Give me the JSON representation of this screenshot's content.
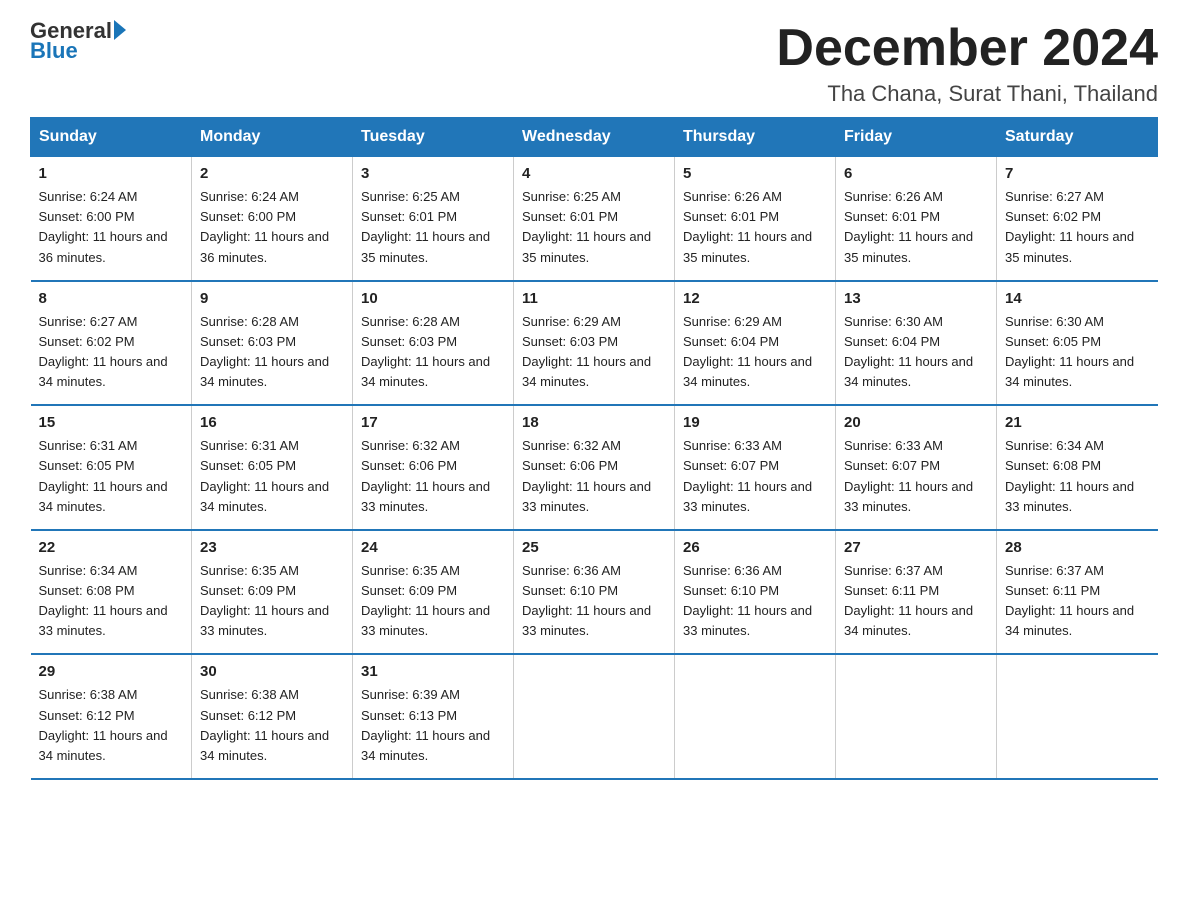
{
  "header": {
    "logo_line1": "General",
    "logo_line2": "Blue",
    "month_title": "December 2024",
    "location": "Tha Chana, Surat Thani, Thailand"
  },
  "days_of_week": [
    "Sunday",
    "Monday",
    "Tuesday",
    "Wednesday",
    "Thursday",
    "Friday",
    "Saturday"
  ],
  "weeks": [
    [
      {
        "day": "1",
        "info": "Sunrise: 6:24 AM\nSunset: 6:00 PM\nDaylight: 11 hours and 36 minutes."
      },
      {
        "day": "2",
        "info": "Sunrise: 6:24 AM\nSunset: 6:00 PM\nDaylight: 11 hours and 36 minutes."
      },
      {
        "day": "3",
        "info": "Sunrise: 6:25 AM\nSunset: 6:01 PM\nDaylight: 11 hours and 35 minutes."
      },
      {
        "day": "4",
        "info": "Sunrise: 6:25 AM\nSunset: 6:01 PM\nDaylight: 11 hours and 35 minutes."
      },
      {
        "day": "5",
        "info": "Sunrise: 6:26 AM\nSunset: 6:01 PM\nDaylight: 11 hours and 35 minutes."
      },
      {
        "day": "6",
        "info": "Sunrise: 6:26 AM\nSunset: 6:01 PM\nDaylight: 11 hours and 35 minutes."
      },
      {
        "day": "7",
        "info": "Sunrise: 6:27 AM\nSunset: 6:02 PM\nDaylight: 11 hours and 35 minutes."
      }
    ],
    [
      {
        "day": "8",
        "info": "Sunrise: 6:27 AM\nSunset: 6:02 PM\nDaylight: 11 hours and 34 minutes."
      },
      {
        "day": "9",
        "info": "Sunrise: 6:28 AM\nSunset: 6:03 PM\nDaylight: 11 hours and 34 minutes."
      },
      {
        "day": "10",
        "info": "Sunrise: 6:28 AM\nSunset: 6:03 PM\nDaylight: 11 hours and 34 minutes."
      },
      {
        "day": "11",
        "info": "Sunrise: 6:29 AM\nSunset: 6:03 PM\nDaylight: 11 hours and 34 minutes."
      },
      {
        "day": "12",
        "info": "Sunrise: 6:29 AM\nSunset: 6:04 PM\nDaylight: 11 hours and 34 minutes."
      },
      {
        "day": "13",
        "info": "Sunrise: 6:30 AM\nSunset: 6:04 PM\nDaylight: 11 hours and 34 minutes."
      },
      {
        "day": "14",
        "info": "Sunrise: 6:30 AM\nSunset: 6:05 PM\nDaylight: 11 hours and 34 minutes."
      }
    ],
    [
      {
        "day": "15",
        "info": "Sunrise: 6:31 AM\nSunset: 6:05 PM\nDaylight: 11 hours and 34 minutes."
      },
      {
        "day": "16",
        "info": "Sunrise: 6:31 AM\nSunset: 6:05 PM\nDaylight: 11 hours and 34 minutes."
      },
      {
        "day": "17",
        "info": "Sunrise: 6:32 AM\nSunset: 6:06 PM\nDaylight: 11 hours and 33 minutes."
      },
      {
        "day": "18",
        "info": "Sunrise: 6:32 AM\nSunset: 6:06 PM\nDaylight: 11 hours and 33 minutes."
      },
      {
        "day": "19",
        "info": "Sunrise: 6:33 AM\nSunset: 6:07 PM\nDaylight: 11 hours and 33 minutes."
      },
      {
        "day": "20",
        "info": "Sunrise: 6:33 AM\nSunset: 6:07 PM\nDaylight: 11 hours and 33 minutes."
      },
      {
        "day": "21",
        "info": "Sunrise: 6:34 AM\nSunset: 6:08 PM\nDaylight: 11 hours and 33 minutes."
      }
    ],
    [
      {
        "day": "22",
        "info": "Sunrise: 6:34 AM\nSunset: 6:08 PM\nDaylight: 11 hours and 33 minutes."
      },
      {
        "day": "23",
        "info": "Sunrise: 6:35 AM\nSunset: 6:09 PM\nDaylight: 11 hours and 33 minutes."
      },
      {
        "day": "24",
        "info": "Sunrise: 6:35 AM\nSunset: 6:09 PM\nDaylight: 11 hours and 33 minutes."
      },
      {
        "day": "25",
        "info": "Sunrise: 6:36 AM\nSunset: 6:10 PM\nDaylight: 11 hours and 33 minutes."
      },
      {
        "day": "26",
        "info": "Sunrise: 6:36 AM\nSunset: 6:10 PM\nDaylight: 11 hours and 33 minutes."
      },
      {
        "day": "27",
        "info": "Sunrise: 6:37 AM\nSunset: 6:11 PM\nDaylight: 11 hours and 34 minutes."
      },
      {
        "day": "28",
        "info": "Sunrise: 6:37 AM\nSunset: 6:11 PM\nDaylight: 11 hours and 34 minutes."
      }
    ],
    [
      {
        "day": "29",
        "info": "Sunrise: 6:38 AM\nSunset: 6:12 PM\nDaylight: 11 hours and 34 minutes."
      },
      {
        "day": "30",
        "info": "Sunrise: 6:38 AM\nSunset: 6:12 PM\nDaylight: 11 hours and 34 minutes."
      },
      {
        "day": "31",
        "info": "Sunrise: 6:39 AM\nSunset: 6:13 PM\nDaylight: 11 hours and 34 minutes."
      },
      {
        "day": "",
        "info": ""
      },
      {
        "day": "",
        "info": ""
      },
      {
        "day": "",
        "info": ""
      },
      {
        "day": "",
        "info": ""
      }
    ]
  ],
  "colors": {
    "header_bg": "#2176b8",
    "header_text": "#ffffff",
    "border": "#2176b8",
    "body_text": "#222222"
  }
}
